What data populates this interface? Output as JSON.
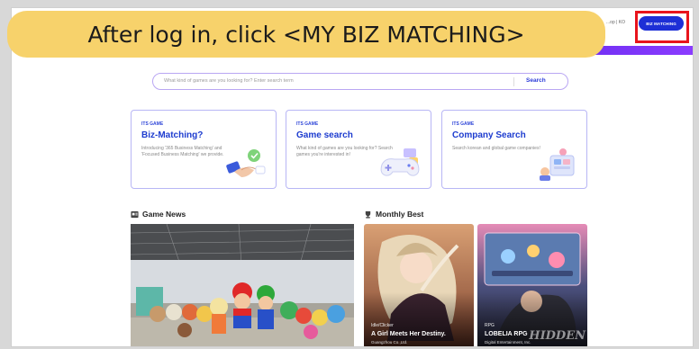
{
  "callout": {
    "text": "After log in, click <MY BIZ MATCHING>"
  },
  "header": {
    "top_links": "...op  |  KO",
    "biz_button": "BIZ MATCHING"
  },
  "search": {
    "placeholder": "What kind of games are you looking for? Enter search term",
    "button": "Search"
  },
  "cards": [
    {
      "tag": "ITS GAME",
      "title": "Biz-Matching?",
      "desc": "Introducing '365 Business Matching' and 'Focused Business Matching' we provide."
    },
    {
      "tag": "ITS GAME",
      "title": "Game search",
      "desc": "What kind of games are you looking for? Search games you're interested in!"
    },
    {
      "tag": "ITS GAME",
      "title": "Company Search",
      "desc": "Search korean and global game companies!"
    }
  ],
  "sections": {
    "news": "Game News",
    "best": "Monthly Best"
  },
  "best_items": [
    {
      "category": "Idle/Clicker",
      "name": "A Girl Meets Her Destiny.",
      "sub": "Guangzhou Co.,Ltd."
    },
    {
      "category": "RPG",
      "name": "LOBELIA RPG",
      "sub": "Digital Entertainment, Inc.",
      "overlay": "HIDDEN"
    }
  ],
  "colors": {
    "accent": "#1d2fd6",
    "callout": "#f7d26b",
    "highlight": "#e8141c",
    "card_border": "#b8b6f5"
  }
}
